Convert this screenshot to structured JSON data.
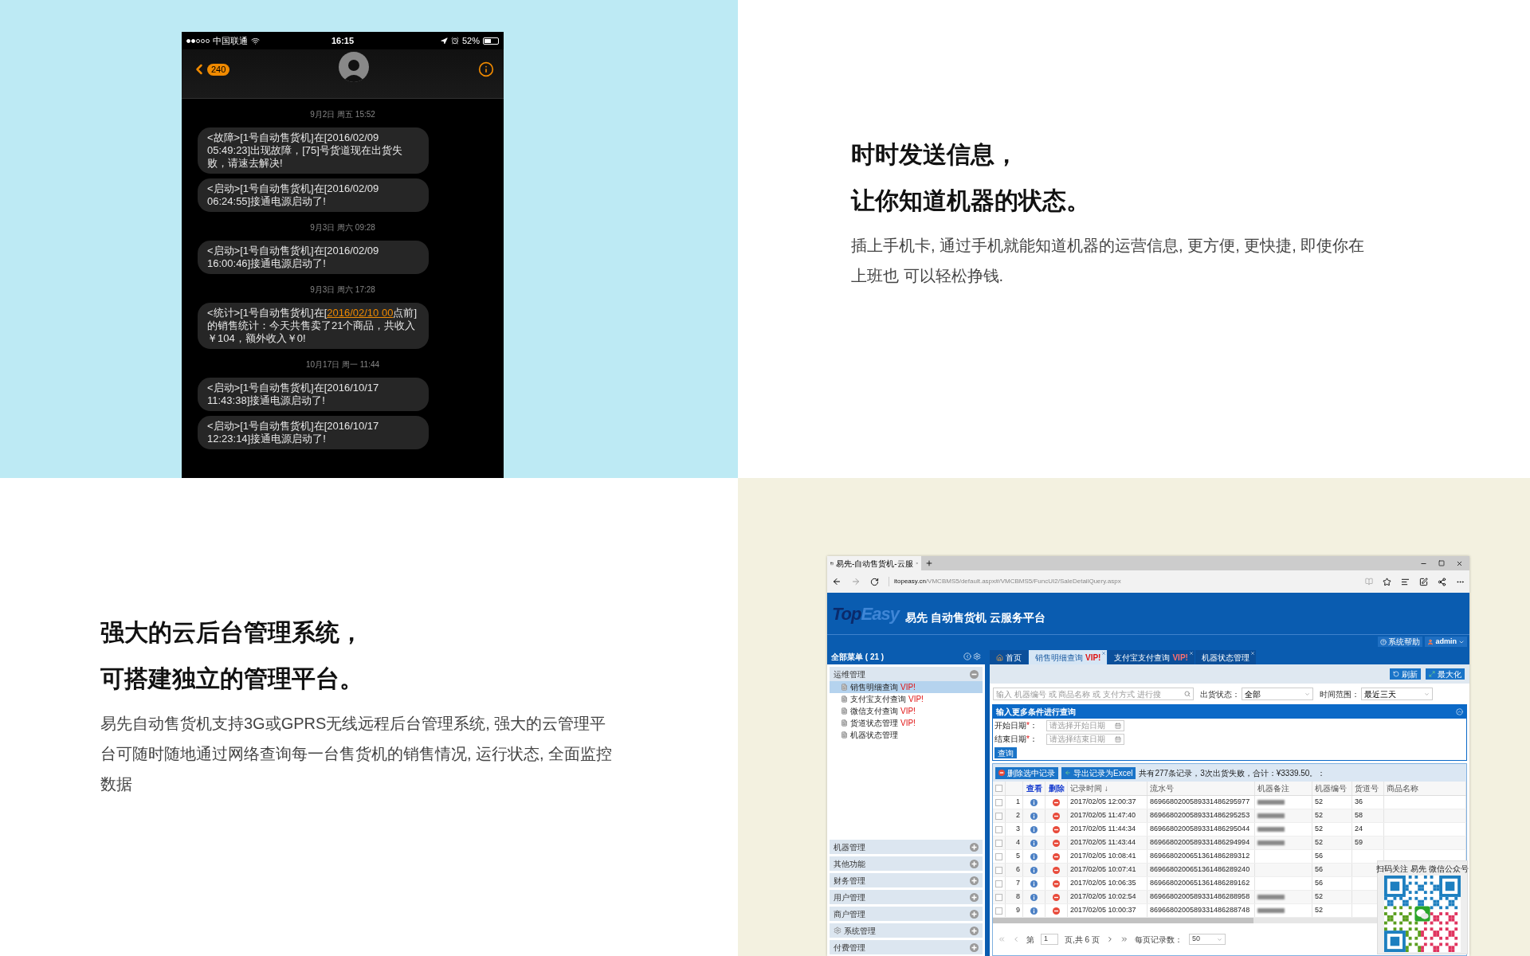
{
  "phone": {
    "status_bar": {
      "carrier": "中国联通",
      "time": "16:15",
      "battery": "52%"
    },
    "back_badge": "240",
    "messages": [
      {
        "kind": "timestamp",
        "text": "9月2日 周五 15:52"
      },
      {
        "kind": "bubble",
        "segments": [
          {
            "text": "<故障>[1号自动售货机]在[2016/02/09 05:49:23]出现故障，[75]号货道现在出货失败，请速去解决!",
            "link": false
          }
        ]
      },
      {
        "kind": "bubble",
        "segments": [
          {
            "text": "<启动>[1号自动售货机]在[2016/02/09 06:24:55]接通电源启动了!",
            "link": false
          }
        ]
      },
      {
        "kind": "timestamp",
        "text": "9月3日 周六 09:28"
      },
      {
        "kind": "bubble",
        "segments": [
          {
            "text": "<启动>[1号自动售货机]在[2016/02/09 16:00:46]接通电源启动了!",
            "link": false
          }
        ]
      },
      {
        "kind": "timestamp",
        "text": "9月3日 周六 17:28"
      },
      {
        "kind": "bubble",
        "segments": [
          {
            "text": "<统计>[1号自动售货机]在[",
            "link": false
          },
          {
            "text": "2016/02/10 00",
            "link": true
          },
          {
            "text": "点前]的销售统计：今天共售卖了21个商品，共收入￥104，额外收入￥0!",
            "link": false
          }
        ]
      },
      {
        "kind": "timestamp",
        "text": "10月17日 周一 11:44"
      },
      {
        "kind": "bubble",
        "segments": [
          {
            "text": "<启动>[1号自动售货机]在[2016/10/17 11:43:38]接通电源启动了!",
            "link": false
          }
        ]
      },
      {
        "kind": "bubble",
        "segments": [
          {
            "text": "<启动>[1号自动售货机]在[2016/10/17 12:23:14]接通电源启动了!",
            "link": false
          }
        ]
      }
    ]
  },
  "feature_messages": {
    "heading_lines": [
      "时时发送信息，",
      "让你知道机器的状态。"
    ],
    "body": "插上手机卡, 通过手机就能知道机器的运营信息, 更方便, 更快捷, 即使你在上班也 可以轻松挣钱."
  },
  "feature_platform": {
    "heading_lines": [
      "强大的云后台管理系统，",
      "可搭建独立的管理平台。"
    ],
    "body": "易先自动售货机支持3G或GPRS无线远程后台管理系统, 强大的云管理平台可随时随地通过网络查询每一台售货机的销售情况, 运行状态, 全面监控数据"
  },
  "browser": {
    "tab_title": "易先-自动售货机-云服",
    "url_domain": "itopeasy.cn",
    "url_path": "/VMCBMS5/default.aspx#/VMCBMS5/FuncUI2/SaleDetailQuery.aspx",
    "logo": {
      "part_1": "Top",
      "part_2": "Easy"
    },
    "site_title": "易先 自动售货机 云服务平台",
    "help_button": "系统帮助",
    "user_menu": "admin",
    "sidebar": {
      "title": "全部菜单 ( 21 )",
      "sections": [
        {
          "label": "运维管理",
          "kind": "plain",
          "expanded": true,
          "children": [
            {
              "label": "销售明细查询",
              "tag": "VIP!",
              "selected": true
            },
            {
              "label": "支付宝支付查询",
              "tag": "VIP!",
              "selected": false
            },
            {
              "label": "微信支付查询",
              "tag": "VIP!",
              "selected": false
            },
            {
              "label": "货道状态管理",
              "tag": "VIP!",
              "selected": false
            },
            {
              "label": "机器状态管理",
              "selected": false
            }
          ]
        },
        {
          "label": "机器管理",
          "kind": "plain",
          "expanded": false
        },
        {
          "label": "其他功能",
          "kind": "plain",
          "expanded": false
        },
        {
          "label": "财务管理",
          "kind": "plain",
          "expanded": false
        },
        {
          "label": "用户管理",
          "kind": "plain",
          "expanded": false
        },
        {
          "label": "商户管理",
          "kind": "plain",
          "expanded": false
        },
        {
          "label": "系统管理",
          "kind": "gear",
          "expanded": false
        },
        {
          "label": "付费管理",
          "kind": "plain",
          "expanded": false
        }
      ]
    },
    "tabs": [
      {
        "label": "首页",
        "kind": "home",
        "selected": false,
        "closable": false
      },
      {
        "label": "销售明细查询",
        "tag": "VIP!",
        "kind": "plain",
        "selected": true,
        "closable": true
      },
      {
        "label": "支付宝支付查询",
        "tag": "VIP!",
        "kind": "plain",
        "selected": false,
        "closable": true
      },
      {
        "label": "机器状态管理",
        "kind": "plain",
        "selected": false,
        "closable": true
      }
    ],
    "toolbar_buttons": [
      {
        "label": "刷新",
        "kind": "refresh"
      },
      {
        "label": "最大化",
        "kind": "maximize"
      }
    ],
    "search": {
      "placeholder": "输入 机器编号 或 商品名称 或 支付方式 进行搜"
    },
    "filters": [
      {
        "label": "出货状态：",
        "value": "全部"
      },
      {
        "label": "时间范围：",
        "value": "最近三天"
      }
    ],
    "query_panel": {
      "title": "输入更多条件进行查询",
      "fields": [
        {
          "label": "开始日期",
          "mark": "*",
          "after": "：",
          "placeholder": "请选择开始日期"
        },
        {
          "label": "结束日期",
          "mark": "*",
          "after": "：",
          "placeholder": "请选择结束日期"
        }
      ],
      "submit": "查询"
    },
    "actions": [
      {
        "label": "删除选中记录",
        "kind": "delete"
      },
      {
        "label": "导出记录为Excel",
        "kind": "export"
      }
    ],
    "summary": "共有277条记录，3次出货失败，合计：¥3339.50。：",
    "table": {
      "header_checked": false,
      "columns": [
        "查看",
        "删除",
        "记录时间 ↓",
        "流水号",
        "机器备注",
        "机器编号",
        "货道号",
        "商品名称"
      ],
      "rows": [
        {
          "index": "1",
          "checked": false,
          "time": "2017/02/05 12:00:37",
          "serial": "8696680200589331486295977",
          "remark_blurred": true,
          "machine": "52",
          "channel": "36"
        },
        {
          "index": "2",
          "checked": false,
          "time": "2017/02/05 11:47:40",
          "serial": "8696680200589331486295253",
          "remark_blurred": true,
          "machine": "52",
          "channel": "58"
        },
        {
          "index": "3",
          "checked": false,
          "time": "2017/02/05 11:44:34",
          "serial": "8696680200589331486295044",
          "remark_blurred": true,
          "machine": "52",
          "channel": "24"
        },
        {
          "index": "4",
          "checked": false,
          "time": "2017/02/05 11:43:44",
          "serial": "8696680200589331486294994",
          "remark_blurred": true,
          "machine": "52",
          "channel": "59"
        },
        {
          "index": "5",
          "checked": false,
          "time": "2017/02/05 10:08:41",
          "serial": "8696680200651361486289312",
          "remark_blurred": false,
          "machine": "56"
        },
        {
          "index": "6",
          "checked": false,
          "time": "2017/02/05 10:07:41",
          "serial": "8696680200651361486289240",
          "remark_blurred": false,
          "machine": "56"
        },
        {
          "index": "7",
          "checked": false,
          "time": "2017/02/05 10:06:35",
          "serial": "8696680200651361486289162",
          "remark_blurred": false,
          "machine": "56"
        },
        {
          "index": "8",
          "checked": false,
          "time": "2017/02/05 10:02:54",
          "serial": "8696680200589331486288958",
          "remark_blurred": true,
          "machine": "52"
        },
        {
          "index": "9",
          "checked": false,
          "time": "2017/02/05 10:00:37",
          "serial": "8696680200589331486288748",
          "remark_blurred": true,
          "machine": "52"
        }
      ]
    },
    "pagination": {
      "page_label": "第",
      "page": "1",
      "page_suffix": "页,共 6 页",
      "per_page_label": "每页记录数：",
      "per_page": "50"
    },
    "qr_overlay": {
      "caption": "扫码关注 易先 微信公众号"
    }
  }
}
